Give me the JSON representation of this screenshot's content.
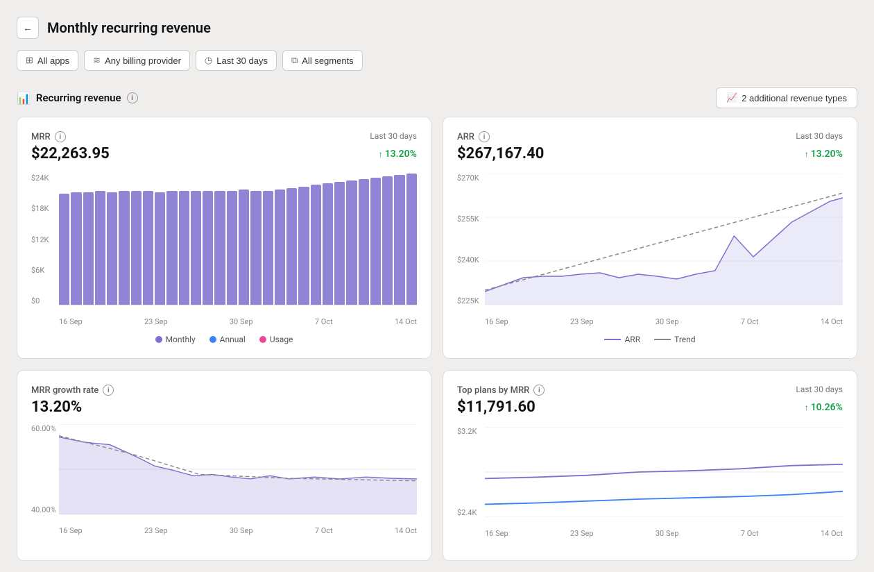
{
  "header": {
    "title": "Monthly recurring revenue",
    "back_label": "←"
  },
  "filters": [
    {
      "id": "apps",
      "icon": "⊞",
      "label": "All apps"
    },
    {
      "id": "billing",
      "icon": "≋",
      "label": "Any billing provider"
    },
    {
      "id": "period",
      "icon": "◷",
      "label": "Last 30 days"
    },
    {
      "id": "segments",
      "icon": "⧉",
      "label": "All segments"
    }
  ],
  "section": {
    "title": "Recurring revenue",
    "additional_btn": "2 additional revenue types"
  },
  "mrr_card": {
    "label": "MRR",
    "period": "Last 30 days",
    "value": "$22,263.95",
    "change": "13.20%",
    "y_labels": [
      "$24K",
      "$18K",
      "$12K",
      "$6K",
      "$0"
    ],
    "x_labels": [
      "16 Sep",
      "23 Sep",
      "30 Sep",
      "7 Oct",
      "14 Oct"
    ],
    "legend": [
      {
        "label": "Monthly",
        "color": "#7c6fcd"
      },
      {
        "label": "Annual",
        "color": "#3b82f6"
      },
      {
        "label": "Usage",
        "color": "#ec4899"
      }
    ],
    "bars": [
      78,
      79,
      79,
      80,
      79,
      80,
      80,
      80,
      79,
      80,
      80,
      80,
      80,
      80,
      80,
      81,
      80,
      80,
      81,
      82,
      83,
      84,
      85,
      86,
      87,
      88,
      89,
      90,
      91,
      92
    ]
  },
  "arr_card": {
    "label": "ARR",
    "period": "Last 30 days",
    "value": "$267,167.40",
    "change": "13.20%",
    "y_labels": [
      "$270K",
      "$255K",
      "$240K",
      "$225K"
    ],
    "x_labels": [
      "16 Sep",
      "23 Sep",
      "30 Sep",
      "7 Oct",
      "14 Oct"
    ],
    "legend": [
      {
        "label": "ARR",
        "color": "#7c6fcd"
      },
      {
        "label": "Trend",
        "color": "#888",
        "dashed": true
      }
    ]
  },
  "growth_card": {
    "label": "MRR growth rate",
    "value": "13.20%",
    "y_labels": [
      "60.00%",
      "40.00%"
    ],
    "x_labels": [
      "16 Sep",
      "23 Sep",
      "30 Sep",
      "7 Oct",
      "14 Oct"
    ]
  },
  "top_plans_card": {
    "label": "Top plans by MRR",
    "period": "Last 30 days",
    "value": "$11,791.60",
    "change": "10.26%",
    "y_labels": [
      "$3.2K",
      "$2.4K"
    ],
    "x_labels": [
      "16 Sep",
      "23 Sep",
      "30 Sep",
      "7 Oct",
      "14 Oct"
    ]
  }
}
